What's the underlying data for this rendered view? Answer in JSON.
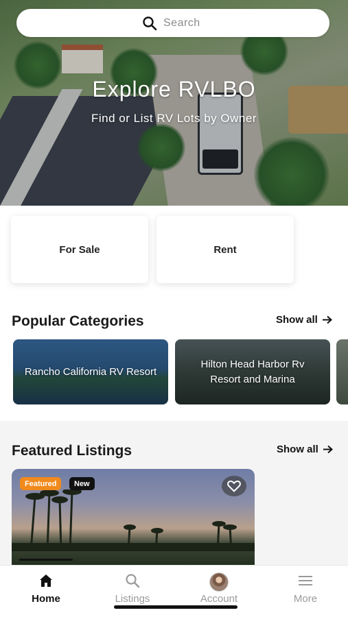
{
  "search": {
    "placeholder": "Search"
  },
  "hero": {
    "title": "Explore RVLBO",
    "subtitle": "Find or List RV Lots by Owner"
  },
  "quick_actions": [
    {
      "label": "For Sale"
    },
    {
      "label": "Rent"
    }
  ],
  "popular": {
    "title": "Popular Categories",
    "show_all": "Show all",
    "items": [
      {
        "label": "Rancho California RV Resort"
      },
      {
        "label": "Hilton Head Harbor Rv Resort and Marina"
      }
    ]
  },
  "featured": {
    "title": "Featured Listings",
    "show_all": "Show all",
    "listing": {
      "badge_featured": "Featured",
      "badge_new": "New"
    }
  },
  "tabs": [
    {
      "label": "Home",
      "icon": "home-icon",
      "active": true
    },
    {
      "label": "Listings",
      "icon": "search-icon"
    },
    {
      "label": "Account",
      "icon": "avatar"
    },
    {
      "label": "More",
      "icon": "menu-icon"
    }
  ],
  "colors": {
    "featured_badge": "#f08a1c",
    "new_badge": "#111111"
  }
}
